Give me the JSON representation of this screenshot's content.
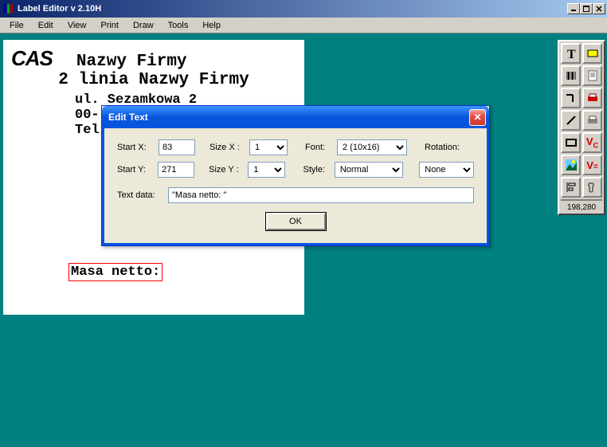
{
  "app": {
    "title": "Label Editor v 2.10H"
  },
  "menu": {
    "file": "File",
    "edit": "Edit",
    "view": "View",
    "print": "Print",
    "draw": "Draw",
    "tools": "Tools",
    "help": "Help"
  },
  "canvas": {
    "logo": "CAS",
    "line1": "Nazwy Firmy",
    "line2": "2 linia Nazwy Firmy",
    "line3": "ul. Sezamkowa 2",
    "line4_partial": "00-",
    "line5_partial": "Tel",
    "selected_text": "Masa netto:"
  },
  "toolbox": {
    "status": "198,280"
  },
  "dialog": {
    "title": "Edit Text",
    "labels": {
      "startx": "Start X:",
      "starty": "Start Y:",
      "sizex": "Size X :",
      "sizey": "Size Y :",
      "font": "Font:",
      "style": "Style:",
      "rotation": "Rotation:",
      "textdata": "Text data:"
    },
    "values": {
      "startx": "83",
      "starty": "271",
      "sizex": "1",
      "sizey": "1",
      "font": "2 (10x16)",
      "style": "Normal",
      "rotation": "None",
      "textdata": "\"Masa netto: \""
    },
    "ok": "OK"
  }
}
